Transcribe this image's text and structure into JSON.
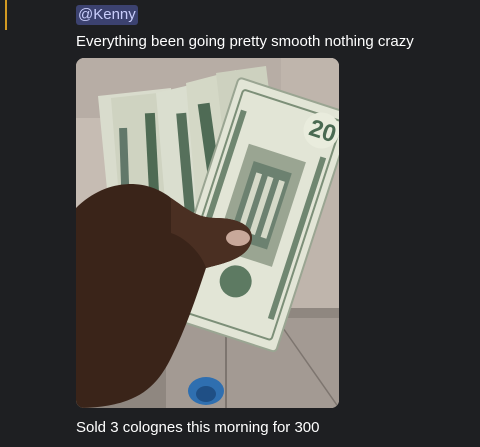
{
  "message": {
    "mention": "@Kenny",
    "text_before_image": "Everything been going pretty smooth nothing crazy",
    "text_after_image": "Sold 3 colognes this morning for 300",
    "accent_color": "#d29922",
    "mention_bg": "#3c4270",
    "mention_fg": "#c9cdfb",
    "background": "#1e1f22"
  },
  "attachment": {
    "bill_denomination": "20"
  }
}
